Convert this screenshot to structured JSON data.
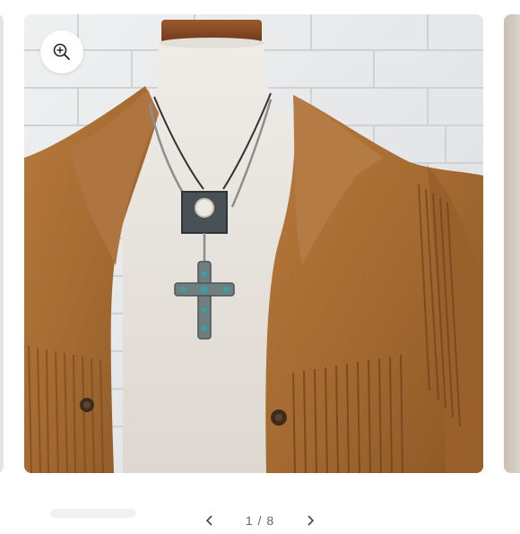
{
  "gallery": {
    "slide_image": {
      "description_icon": "product-photo",
      "colors": {
        "wall": "#e7e8ea",
        "suede": "#a86d35",
        "mannequin": "#e9e6e1",
        "stand_cap": "#8a4a24"
      }
    },
    "zoom_button": {
      "icon": "zoom-in-icon"
    },
    "pager": {
      "prev_icon": "chevron-left-icon",
      "counter": "1 / 8",
      "next_icon": "chevron-right-icon"
    }
  }
}
